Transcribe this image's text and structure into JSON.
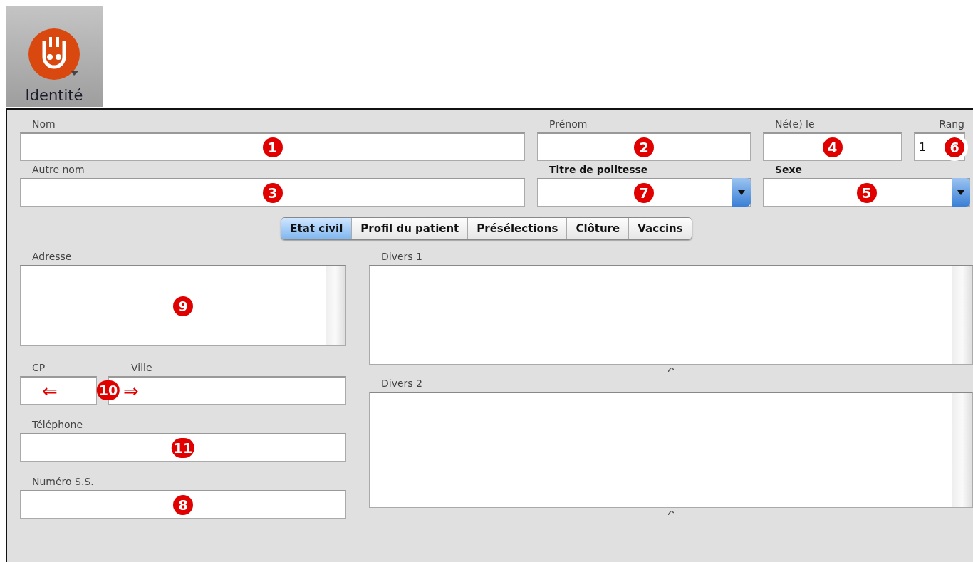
{
  "app_icon": {
    "label": "Identité"
  },
  "header_rows": [
    [
      {
        "label": "Nom",
        "kind": "text",
        "marker": "1"
      },
      {
        "label": "Prénom",
        "kind": "text",
        "marker": "2"
      },
      {
        "label": "Né(e) le",
        "kind": "text",
        "marker": "4"
      },
      {
        "label": "Rang",
        "kind": "text",
        "value": "1",
        "marker": "6"
      }
    ],
    [
      {
        "label": "Autre nom",
        "kind": "text",
        "marker": "3"
      },
      {
        "label": "Titre de politesse",
        "kind": "select",
        "marker": "7"
      },
      {
        "label": "Sexe",
        "kind": "select",
        "marker": "5"
      }
    ]
  ],
  "tabs": [
    {
      "label": "Etat civil",
      "selected": true
    },
    {
      "label": "Profil du patient",
      "selected": false
    },
    {
      "label": "Présélections",
      "selected": false
    },
    {
      "label": "Clôture",
      "selected": false
    },
    {
      "label": "Vaccins",
      "selected": false
    }
  ],
  "address": {
    "label": "Adresse",
    "marker": "9"
  },
  "postal": {
    "cp_label": "CP",
    "city_label": "Ville",
    "marker": "10",
    "left_arrow": "⇐",
    "right_arrow": "⇒"
  },
  "left_fields": [
    {
      "label": "Téléphone",
      "marker": "11"
    },
    {
      "label": "Numéro S.S.",
      "marker": "8"
    }
  ],
  "notes": [
    {
      "label": "Divers 1"
    },
    {
      "label": "Divers 2"
    }
  ]
}
